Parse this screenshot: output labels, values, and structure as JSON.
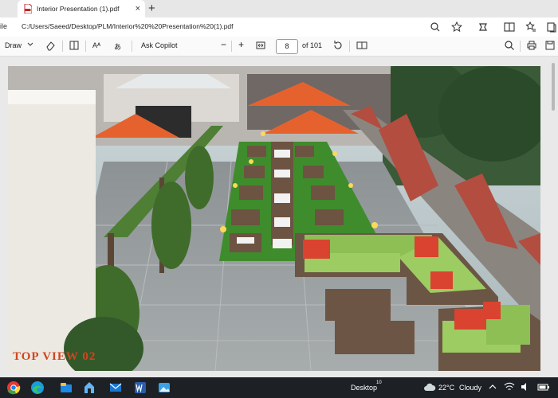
{
  "browser": {
    "tab_title": "Interior Presentation (1).pdf",
    "tab_close": "×",
    "new_tab": "+",
    "address_prefix": "ile",
    "url": "C:/Users/Saeed/Desktop/PLM/Interior%20%20Presentation%20(1).pdf"
  },
  "pdf_toolbar": {
    "draw_label": "Draw",
    "read_aloud_label": "Aᴬ",
    "translate_label": "あ",
    "ask_copilot_label": "Ask Copilot",
    "zoom_out": "−",
    "zoom_in": "+",
    "current_page": "8",
    "page_total_label": "of 101"
  },
  "document": {
    "caption": "TOP VIEW 02"
  },
  "taskbar": {
    "desktop_label": "Desktop",
    "desktop_badge": "10",
    "weather_temp": "22°C",
    "weather_desc": "Cloudy"
  }
}
